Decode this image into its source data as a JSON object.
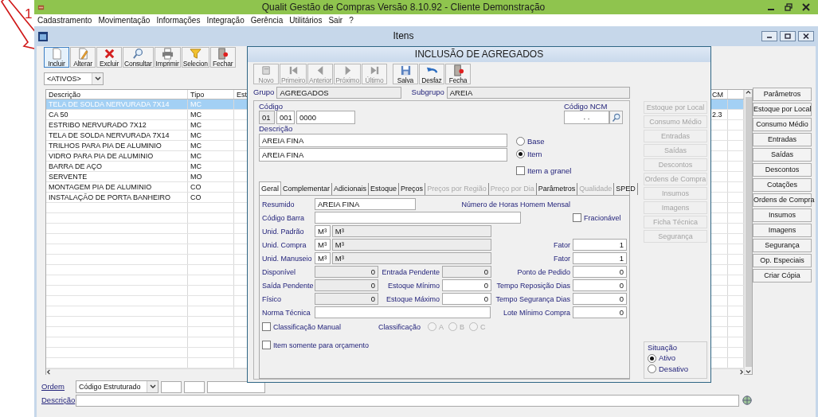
{
  "app": {
    "title": "Qualit Gestão de Compras Versão 8.10.92 - Cliente Demonstração"
  },
  "annotation": {
    "label": "1"
  },
  "menu": [
    "Cadastramento",
    "Movimentação",
    "Informações",
    "Integração",
    "Gerência",
    "Utilitários",
    "Sair",
    "?"
  ],
  "itens_window": {
    "title": "Itens",
    "toolbar": [
      {
        "label": "Incluir",
        "selected": true
      },
      {
        "label": "Alterar",
        "selected": false
      },
      {
        "label": "Excluir",
        "selected": false
      },
      {
        "label": "Consultar",
        "selected": false
      },
      {
        "label": "Imprimir",
        "selected": false
      },
      {
        "label": "Selecion",
        "selected": false
      },
      {
        "label": "Fechar",
        "selected": false
      }
    ],
    "filter": "<ATIVOS>",
    "columns": [
      "Descrição",
      "Tipo",
      "Est",
      "CM"
    ],
    "rows": [
      {
        "description": "TELA DE SOLDA NERVURADA 7X14",
        "type": "MC",
        "selected": true
      },
      {
        "description": "CA 50",
        "type": "MC",
        "ncm": "2.3",
        "selected": false
      },
      {
        "description": "ESTRIBO NERVURADO 7X12",
        "type": "MC",
        "selected": false
      },
      {
        "description": "TELA DE SOLDA NERVURADA 7X14",
        "type": "MC",
        "selected": false
      },
      {
        "description": "TRILHOS PARA PIA DE ALUMINIO",
        "type": "MC",
        "selected": false
      },
      {
        "description": "VIDRO PARA PIA DE ALUMINIO",
        "type": "MC",
        "selected": false
      },
      {
        "description": "BARRA DE AÇO",
        "type": "MC",
        "selected": false
      },
      {
        "description": "SERVENTE",
        "type": "MO",
        "selected": false
      },
      {
        "description": "MONTAGEM PIA DE ALUMINIO",
        "type": "CO",
        "selected": false
      },
      {
        "description": "INSTALAÇÃO DE PORTA BANHEIRO",
        "type": "CO",
        "selected": false
      }
    ],
    "order": {
      "label": "Ordem",
      "value": "Código Estruturado"
    },
    "search": {
      "label": "Descrição"
    },
    "side_buttons": [
      "Parâmetros",
      "Estoque por Local",
      "Consumo Médio",
      "Entradas",
      "Saídas",
      "Descontos",
      "Cotações",
      "Ordens de Compra",
      "Insumos",
      "Imagens",
      "Segurança",
      "Op. Especiais",
      "Criar Cópia"
    ]
  },
  "dialog": {
    "title": "INCLUSÃO DE AGREGADOS",
    "toolbar": [
      {
        "label": "Novo",
        "disabled": true
      },
      {
        "label": "Primeiro",
        "disabled": true
      },
      {
        "label": "Anterior",
        "disabled": true
      },
      {
        "label": "Próximo",
        "disabled": true
      },
      {
        "label": "Último",
        "disabled": true
      },
      {
        "label": "Salva",
        "disabled": false
      },
      {
        "label": "Desfaz",
        "disabled": false
      },
      {
        "label": "Fecha",
        "disabled": false
      }
    ],
    "grupo": {
      "label": "Grupo",
      "value": "AGREGADOS"
    },
    "subgrupo": {
      "label": "Subgrupo",
      "value": "AREIA"
    },
    "codigo": {
      "label": "Código",
      "parts": [
        {
          "value": "01",
          "readonly": true
        },
        {
          "value": "001",
          "readonly": false
        },
        {
          "value": "0000",
          "readonly": false
        }
      ]
    },
    "ncm": {
      "label": "Código NCM",
      "value": ". ."
    },
    "descricao": {
      "label": "Descrição",
      "lines": [
        "AREIA FINA",
        "AREIA FINA"
      ]
    },
    "nature": [
      {
        "label": "Base",
        "selected": false
      },
      {
        "label": "Item",
        "selected": true
      }
    ],
    "granel": {
      "label": "Item a granel",
      "checked": false
    },
    "tabs": [
      {
        "label": "Geral",
        "selected": true,
        "disabled": false
      },
      {
        "label": "Complementar",
        "selected": false,
        "disabled": false
      },
      {
        "label": "Adicionais",
        "selected": false,
        "disabled": false
      },
      {
        "label": "Estoque",
        "selected": false,
        "disabled": false
      },
      {
        "label": "Preços",
        "selected": false,
        "disabled": false
      },
      {
        "label": "Preços por Região",
        "selected": false,
        "disabled": true
      },
      {
        "label": "Preço por Dia",
        "selected": false,
        "disabled": true
      },
      {
        "label": "Parâmetros",
        "selected": false,
        "disabled": false
      },
      {
        "label": "Qualidade",
        "selected": false,
        "disabled": true
      },
      {
        "label": "SPED",
        "selected": false,
        "disabled": false
      }
    ],
    "geral": {
      "resumido": {
        "label": "Resumido",
        "value": "AREIA FINA"
      },
      "horas_label": "Número de Horas Homem Mensal",
      "codigo_barra": {
        "label": "Código Barra"
      },
      "fracionavel": {
        "label": "Fracionável",
        "checked": false
      },
      "units": [
        {
          "label": "Unid. Padrão",
          "code": "M³",
          "name": "M³"
        },
        {
          "label": "Unid. Compra",
          "code": "M³",
          "name": "M³",
          "factor_label": "Fator",
          "factor": "1"
        },
        {
          "label": "Unid. Manuseio",
          "code": "M³",
          "name": "M³",
          "factor_label": "Fator",
          "factor": "1"
        }
      ],
      "stock_rows": [
        [
          {
            "kind": "number",
            "label": "Disponível",
            "value": "0",
            "readonly": true
          },
          {
            "kind": "number",
            "label": "Entrada Pendente",
            "value": "0",
            "readonly": true
          },
          {
            "kind": "number",
            "label": "Ponto de Pedido",
            "value": "0",
            "readonly": false
          }
        ],
        [
          {
            "kind": "number",
            "label": "Saída Pendente",
            "value": "0",
            "readonly": true
          },
          {
            "kind": "number",
            "label": "Estoque Mínimo",
            "value": "0",
            "readonly": false
          },
          {
            "kind": "number",
            "label": "Tempo Reposição Dias",
            "value": "0",
            "readonly": false
          }
        ],
        [
          {
            "kind": "number",
            "label": "Físico",
            "value": "0",
            "readonly": true
          },
          {
            "kind": "number",
            "label": "Estoque Máximo",
            "value": "0",
            "readonly": false
          },
          {
            "kind": "number",
            "label": "Tempo Segurança Dias",
            "value": "0",
            "readonly": false
          }
        ],
        [
          {
            "kind": "wide",
            "label": "Norma Técnica"
          },
          {
            "kind": "number",
            "label": "Lote Mínimo Compra",
            "value": "0",
            "readonly": false
          }
        ]
      ],
      "classificacao_manual": {
        "label": "Classificação Manual",
        "checked": false
      },
      "classificacao": {
        "label": "Classificação",
        "disabled": true,
        "options": [
          {
            "label": "A",
            "selected": false
          },
          {
            "label": "B",
            "selected": false
          },
          {
            "label": "C",
            "selected": false
          }
        ]
      },
      "orcamento": {
        "label": "Item somente para orçamento",
        "checked": false
      }
    },
    "side_buttons": [
      {
        "label": "Estoque por Local",
        "disabled": true
      },
      {
        "label": "Consumo Médio",
        "disabled": true
      },
      {
        "label": "Entradas",
        "disabled": true
      },
      {
        "label": "Saídas",
        "disabled": true
      },
      {
        "label": "Descontos",
        "disabled": true
      },
      {
        "label": "Ordens de Compra",
        "disabled": true
      },
      {
        "label": "Insumos",
        "disabled": true
      },
      {
        "label": "Imagens",
        "disabled": true
      },
      {
        "label": "Ficha Técnica",
        "disabled": true
      },
      {
        "label": "Segurança",
        "disabled": true
      }
    ],
    "situacao": {
      "label": "Situação",
      "options": [
        {
          "label": "Ativo",
          "selected": true
        },
        {
          "label": "Desativo",
          "selected": false
        }
      ]
    }
  }
}
